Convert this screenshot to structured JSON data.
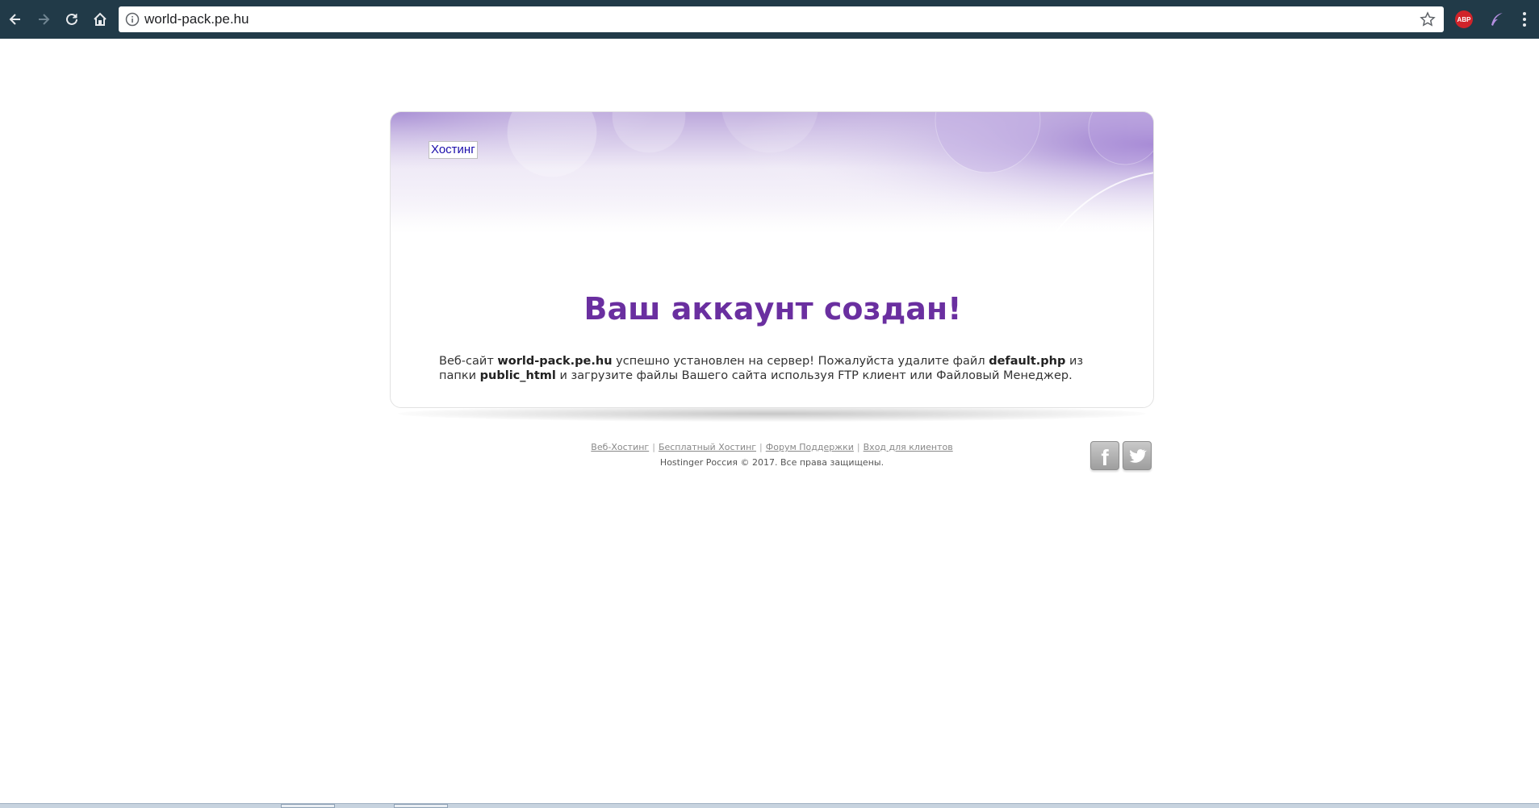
{
  "browser": {
    "url": "world-pack.pe.hu",
    "abp_label": "ABP"
  },
  "page": {
    "logo_alt": "Хостинг",
    "title": "Ваш аккаунт создан!",
    "message": {
      "t1": "Веб-сайт ",
      "domain": "world-pack.pe.hu",
      "t2": " успешно установлен на сервер! Пожалуйста удалите файл ",
      "file": "default.php",
      "t3": " из папки ",
      "folder": "public_html",
      "t4": " и загрузите файлы Вашего сайта используя FTP клиент или Файловый Менеджер."
    }
  },
  "footer": {
    "links": [
      "Веб-Хостинг",
      "Бесплатный Хостинг",
      "Форум Поддержки",
      "Вход для клиентов"
    ],
    "separator": "|",
    "copyright": "Hostinger Россия © 2017. Все права защищены.",
    "facebook_glyph": "f"
  },
  "colors": {
    "chrome": "#213a48",
    "title": "#6a2fa0",
    "accent_purple": "#9d7fd0"
  },
  "icons": [
    "back-icon",
    "forward-icon",
    "reload-icon",
    "home-icon",
    "info-icon",
    "star-icon",
    "adblock-icon",
    "feather-icon",
    "menu-icon",
    "facebook-icon",
    "twitter-icon"
  ]
}
